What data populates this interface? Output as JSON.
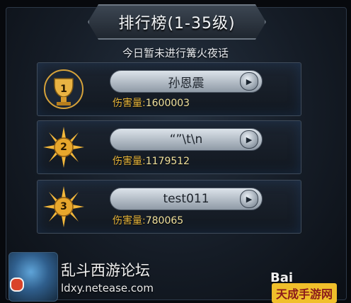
{
  "header": {
    "title": "排行榜(1-35级)"
  },
  "notice": "今日暂未进行篝火夜话",
  "rankings": [
    {
      "rank": "1",
      "name": "孙恩震",
      "damage_label": "伤害量:",
      "damage_value": "1600003"
    },
    {
      "rank": "2",
      "name": "“”\\t\\n",
      "damage_label": "伤害量:",
      "damage_value": "1179512"
    },
    {
      "rank": "3",
      "name": "test011",
      "damage_label": "伤害量:",
      "damage_value": "780065"
    }
  ],
  "footer": {
    "title": "乱斗西游论坛",
    "url": "ldxy.netease.com",
    "baidu": "Bai",
    "corner": "天成手游网"
  },
  "colors": {
    "damage_label": "#e6b43a",
    "damage_value": "#f1e19c",
    "gold_badge": "#e8a92d"
  }
}
